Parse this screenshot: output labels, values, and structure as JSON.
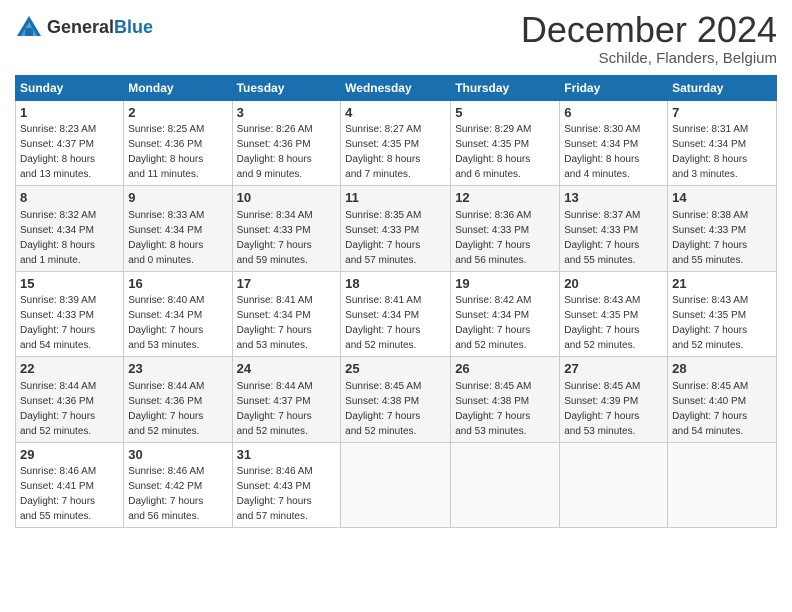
{
  "header": {
    "logo_general": "General",
    "logo_blue": "Blue",
    "month_title": "December 2024",
    "location": "Schilde, Flanders, Belgium"
  },
  "weekdays": [
    "Sunday",
    "Monday",
    "Tuesday",
    "Wednesday",
    "Thursday",
    "Friday",
    "Saturday"
  ],
  "weeks": [
    [
      {
        "day": "1",
        "info": "Sunrise: 8:23 AM\nSunset: 4:37 PM\nDaylight: 8 hours\nand 13 minutes."
      },
      {
        "day": "2",
        "info": "Sunrise: 8:25 AM\nSunset: 4:36 PM\nDaylight: 8 hours\nand 11 minutes."
      },
      {
        "day": "3",
        "info": "Sunrise: 8:26 AM\nSunset: 4:36 PM\nDaylight: 8 hours\nand 9 minutes."
      },
      {
        "day": "4",
        "info": "Sunrise: 8:27 AM\nSunset: 4:35 PM\nDaylight: 8 hours\nand 7 minutes."
      },
      {
        "day": "5",
        "info": "Sunrise: 8:29 AM\nSunset: 4:35 PM\nDaylight: 8 hours\nand 6 minutes."
      },
      {
        "day": "6",
        "info": "Sunrise: 8:30 AM\nSunset: 4:34 PM\nDaylight: 8 hours\nand 4 minutes."
      },
      {
        "day": "7",
        "info": "Sunrise: 8:31 AM\nSunset: 4:34 PM\nDaylight: 8 hours\nand 3 minutes."
      }
    ],
    [
      {
        "day": "8",
        "info": "Sunrise: 8:32 AM\nSunset: 4:34 PM\nDaylight: 8 hours\nand 1 minute."
      },
      {
        "day": "9",
        "info": "Sunrise: 8:33 AM\nSunset: 4:34 PM\nDaylight: 8 hours\nand 0 minutes."
      },
      {
        "day": "10",
        "info": "Sunrise: 8:34 AM\nSunset: 4:33 PM\nDaylight: 7 hours\nand 59 minutes."
      },
      {
        "day": "11",
        "info": "Sunrise: 8:35 AM\nSunset: 4:33 PM\nDaylight: 7 hours\nand 57 minutes."
      },
      {
        "day": "12",
        "info": "Sunrise: 8:36 AM\nSunset: 4:33 PM\nDaylight: 7 hours\nand 56 minutes."
      },
      {
        "day": "13",
        "info": "Sunrise: 8:37 AM\nSunset: 4:33 PM\nDaylight: 7 hours\nand 55 minutes."
      },
      {
        "day": "14",
        "info": "Sunrise: 8:38 AM\nSunset: 4:33 PM\nDaylight: 7 hours\nand 55 minutes."
      }
    ],
    [
      {
        "day": "15",
        "info": "Sunrise: 8:39 AM\nSunset: 4:33 PM\nDaylight: 7 hours\nand 54 minutes."
      },
      {
        "day": "16",
        "info": "Sunrise: 8:40 AM\nSunset: 4:34 PM\nDaylight: 7 hours\nand 53 minutes."
      },
      {
        "day": "17",
        "info": "Sunrise: 8:41 AM\nSunset: 4:34 PM\nDaylight: 7 hours\nand 53 minutes."
      },
      {
        "day": "18",
        "info": "Sunrise: 8:41 AM\nSunset: 4:34 PM\nDaylight: 7 hours\nand 52 minutes."
      },
      {
        "day": "19",
        "info": "Sunrise: 8:42 AM\nSunset: 4:34 PM\nDaylight: 7 hours\nand 52 minutes."
      },
      {
        "day": "20",
        "info": "Sunrise: 8:43 AM\nSunset: 4:35 PM\nDaylight: 7 hours\nand 52 minutes."
      },
      {
        "day": "21",
        "info": "Sunrise: 8:43 AM\nSunset: 4:35 PM\nDaylight: 7 hours\nand 52 minutes."
      }
    ],
    [
      {
        "day": "22",
        "info": "Sunrise: 8:44 AM\nSunset: 4:36 PM\nDaylight: 7 hours\nand 52 minutes."
      },
      {
        "day": "23",
        "info": "Sunrise: 8:44 AM\nSunset: 4:36 PM\nDaylight: 7 hours\nand 52 minutes."
      },
      {
        "day": "24",
        "info": "Sunrise: 8:44 AM\nSunset: 4:37 PM\nDaylight: 7 hours\nand 52 minutes."
      },
      {
        "day": "25",
        "info": "Sunrise: 8:45 AM\nSunset: 4:38 PM\nDaylight: 7 hours\nand 52 minutes."
      },
      {
        "day": "26",
        "info": "Sunrise: 8:45 AM\nSunset: 4:38 PM\nDaylight: 7 hours\nand 53 minutes."
      },
      {
        "day": "27",
        "info": "Sunrise: 8:45 AM\nSunset: 4:39 PM\nDaylight: 7 hours\nand 53 minutes."
      },
      {
        "day": "28",
        "info": "Sunrise: 8:45 AM\nSunset: 4:40 PM\nDaylight: 7 hours\nand 54 minutes."
      }
    ],
    [
      {
        "day": "29",
        "info": "Sunrise: 8:46 AM\nSunset: 4:41 PM\nDaylight: 7 hours\nand 55 minutes."
      },
      {
        "day": "30",
        "info": "Sunrise: 8:46 AM\nSunset: 4:42 PM\nDaylight: 7 hours\nand 56 minutes."
      },
      {
        "day": "31",
        "info": "Sunrise: 8:46 AM\nSunset: 4:43 PM\nDaylight: 7 hours\nand 57 minutes."
      },
      {
        "day": "",
        "info": ""
      },
      {
        "day": "",
        "info": ""
      },
      {
        "day": "",
        "info": ""
      },
      {
        "day": "",
        "info": ""
      }
    ]
  ]
}
